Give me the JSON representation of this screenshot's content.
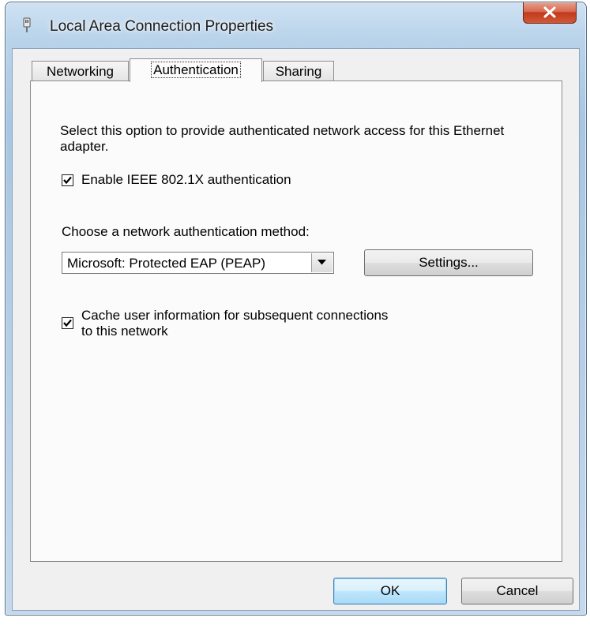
{
  "window": {
    "title": "Local Area Connection Properties"
  },
  "tabs": [
    {
      "label": "Networking",
      "active": false
    },
    {
      "label": "Authentication",
      "active": true
    },
    {
      "label": "Sharing",
      "active": false
    }
  ],
  "authentication": {
    "description": "Select this option to provide authenticated network access for this Ethernet adapter.",
    "enable_8021x": {
      "label": "Enable IEEE 802.1X authentication",
      "checked": true
    },
    "method_label": "Choose a network authentication method:",
    "method_selected": "Microsoft: Protected EAP (PEAP)",
    "settings_button": "Settings...",
    "cache": {
      "label_line1": "Cache user information for subsequent connections",
      "label_line2": "to this network",
      "checked": true
    }
  },
  "footer": {
    "ok": "OK",
    "cancel": "Cancel"
  }
}
